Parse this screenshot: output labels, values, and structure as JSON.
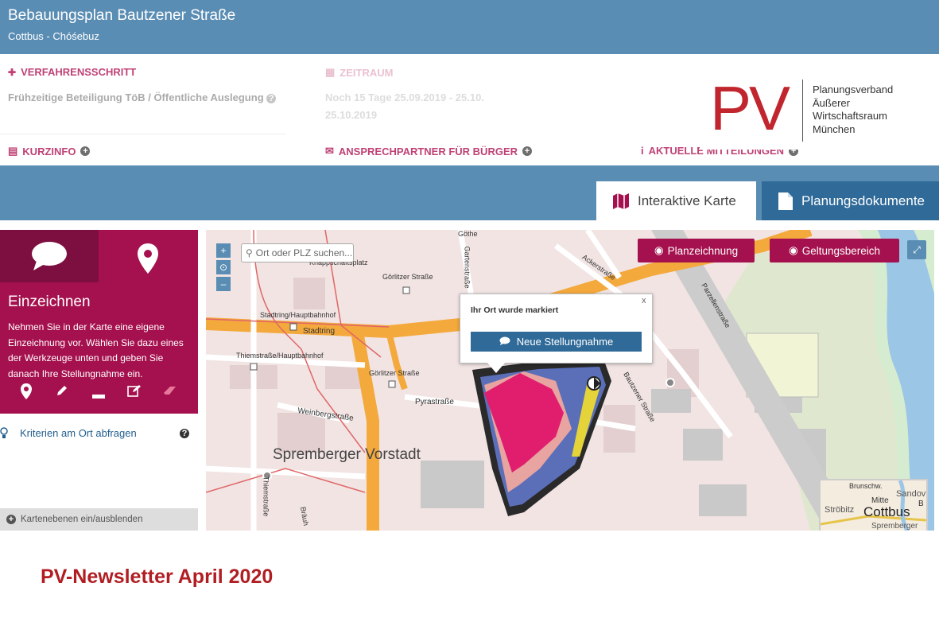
{
  "header": {
    "title": "Bebauungsplan Bautzener Straße",
    "subtitle": "Cottbus - Chóśebuz"
  },
  "info": {
    "verfahren_label": "VERFAHRENSSCHRITT",
    "verfahren_value": "Frühzeitige Beteiligung TöB / Öffentliche Auslegung",
    "zeitraum_label": "ZEITRAUM",
    "zeitraum_value_1": "Noch 15 Tage 25.09.2019 - 25.10.",
    "zeitraum_value_2": "25.10.2019",
    "kurzinfo_label": "KURZINFO",
    "ansprech_label": "ANSPRECHPARTNER FÜR BÜRGER",
    "mitteilungen_label": "AKTUELLE MITTEILUNGEN"
  },
  "logo": {
    "letters": "PV",
    "line1": "Planungsverband",
    "line2": "Äußerer",
    "line3": "Wirtschaftsraum",
    "line4": "München"
  },
  "tabs": [
    {
      "label": "Interaktive Karte",
      "icon": "map-icon"
    },
    {
      "label": "Planungsdokumente",
      "icon": "document-icon"
    }
  ],
  "panel": {
    "heading": "Einzeichnen",
    "description": "Nehmen Sie in der Karte eine eigene Einzeichnung vor. Wählen Sie dazu eines der Werkzeuge unten und geben Sie danach Ihre Stellungnahme ein.",
    "criteria_label": "Kriterien am Ort abfragen",
    "layers_label": "Kartenebenen ein/ausblenden"
  },
  "map": {
    "search_placeholder": "Ort oder PLZ suchen...",
    "zoom_in": "+",
    "zoom_reset": "⊙",
    "zoom_out": "–",
    "btn_planzeichnung": "Planzeichnung",
    "btn_geltungsbereich": "Geltungsbereich",
    "popup_title": "Ihr Ort wurde markiert",
    "popup_close": "x",
    "popup_button": "Neue Stellungnahme",
    "labels": {
      "knappschaftsplatz": "Knappschaftsplatz",
      "goerlitzer1": "Görlitzer Straße",
      "stadtring_hbf": "Stadtring/Hauptbahnhof",
      "stadtring": "Stadtring",
      "thiemstr_hbf": "Thiemstraße/Hauptbahnhof",
      "goerlitzer2": "Görlitzer Straße",
      "pyrastrasse": "Pyrastraße",
      "weinbergstrasse": "Weinbergstraße",
      "spremberger_vorstadt": "Spremberger Vorstadt",
      "gartenstrasse": "Gartenstraße",
      "ackerstrasse": "Ackerstraße",
      "parzellenstrasse": "Parzellenstraße",
      "bautzener": "Bautzener Straße",
      "thiemstrasse": "Thiemstraße",
      "braeuhaus": "Bräuh",
      "goeth": "Göthe"
    },
    "minimap": {
      "brunschw": "Brunschw.",
      "sandow": "Sandov",
      "mitte": "Mitte",
      "b": "B",
      "stroebitz": "Ströbitz",
      "cottbus": "Cottbus",
      "spremberger": "Spremberger"
    }
  },
  "footer": {
    "newsletter": "PV-Newsletter April 2020"
  },
  "colors": {
    "header_blue": "#5a8db3",
    "accent_magenta": "#a5114e",
    "logo_red": "#c1262f",
    "newsletter_red": "#b01e23"
  }
}
